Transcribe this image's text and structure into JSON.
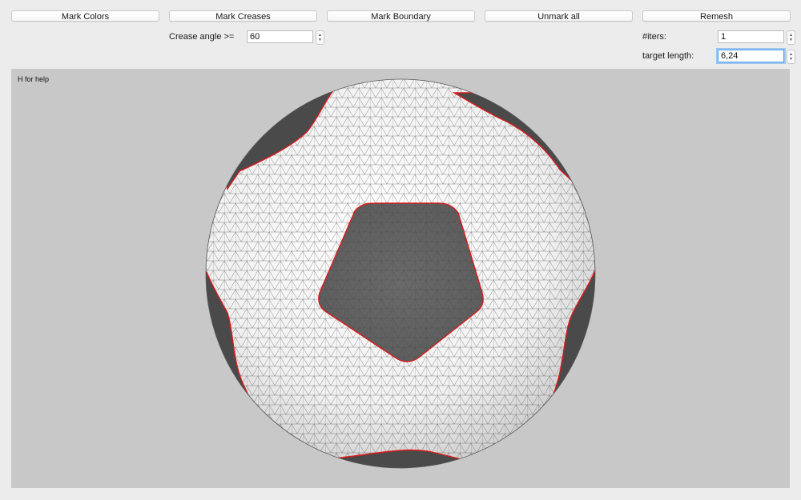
{
  "toolbar": {
    "mark_colors": "Mark Colors",
    "mark_creases": "Mark Creases",
    "mark_boundary": "Mark Boundary",
    "unmark_all": "Unmark all",
    "remesh": "Remesh"
  },
  "crease": {
    "label": "Crease angle >=",
    "value": "60"
  },
  "iters": {
    "label": "#iters:",
    "value": "1"
  },
  "target_length": {
    "label": "target length:",
    "value": "6,24"
  },
  "viewport": {
    "help_text": "H for help",
    "background_color": "#c8c8c8",
    "mesh_patch_color": "#6e6e6e",
    "boundary_color": "#e01818",
    "surface_color": "#f4f4f4"
  }
}
